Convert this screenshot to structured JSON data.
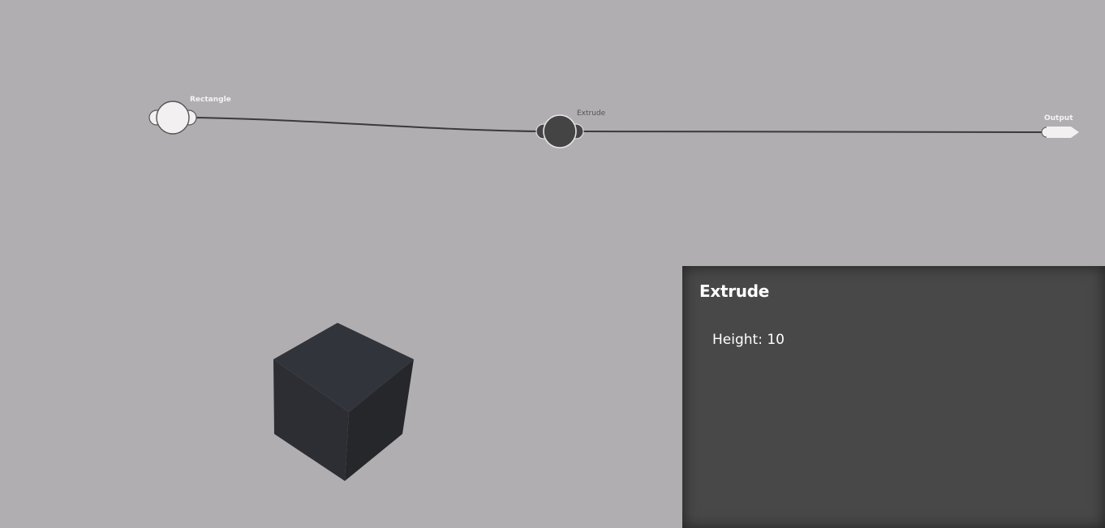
{
  "graph": {
    "nodes": [
      {
        "id": "rectangle",
        "label": "Rectangle",
        "state": "light"
      },
      {
        "id": "extrude",
        "label": "Extrude",
        "state": "selected"
      },
      {
        "id": "output",
        "label": "Output",
        "state": "output"
      }
    ],
    "connections": [
      {
        "from": "rectangle",
        "to": "extrude"
      },
      {
        "from": "extrude",
        "to": "output"
      }
    ]
  },
  "inspector": {
    "title": "Extrude",
    "params": [
      {
        "name": "Height",
        "value": "10",
        "display": "Height: 10"
      }
    ]
  },
  "viewport": {
    "object": "cube"
  },
  "colors": {
    "background": "#b0aeb0",
    "node_light": "#f2f0f0",
    "node_dark": "#444444",
    "edge": "#3a3a3a",
    "panel": "#484848",
    "cube_top": "#32343b",
    "cube_left": "#2c2e33",
    "cube_right": "#25272b"
  }
}
